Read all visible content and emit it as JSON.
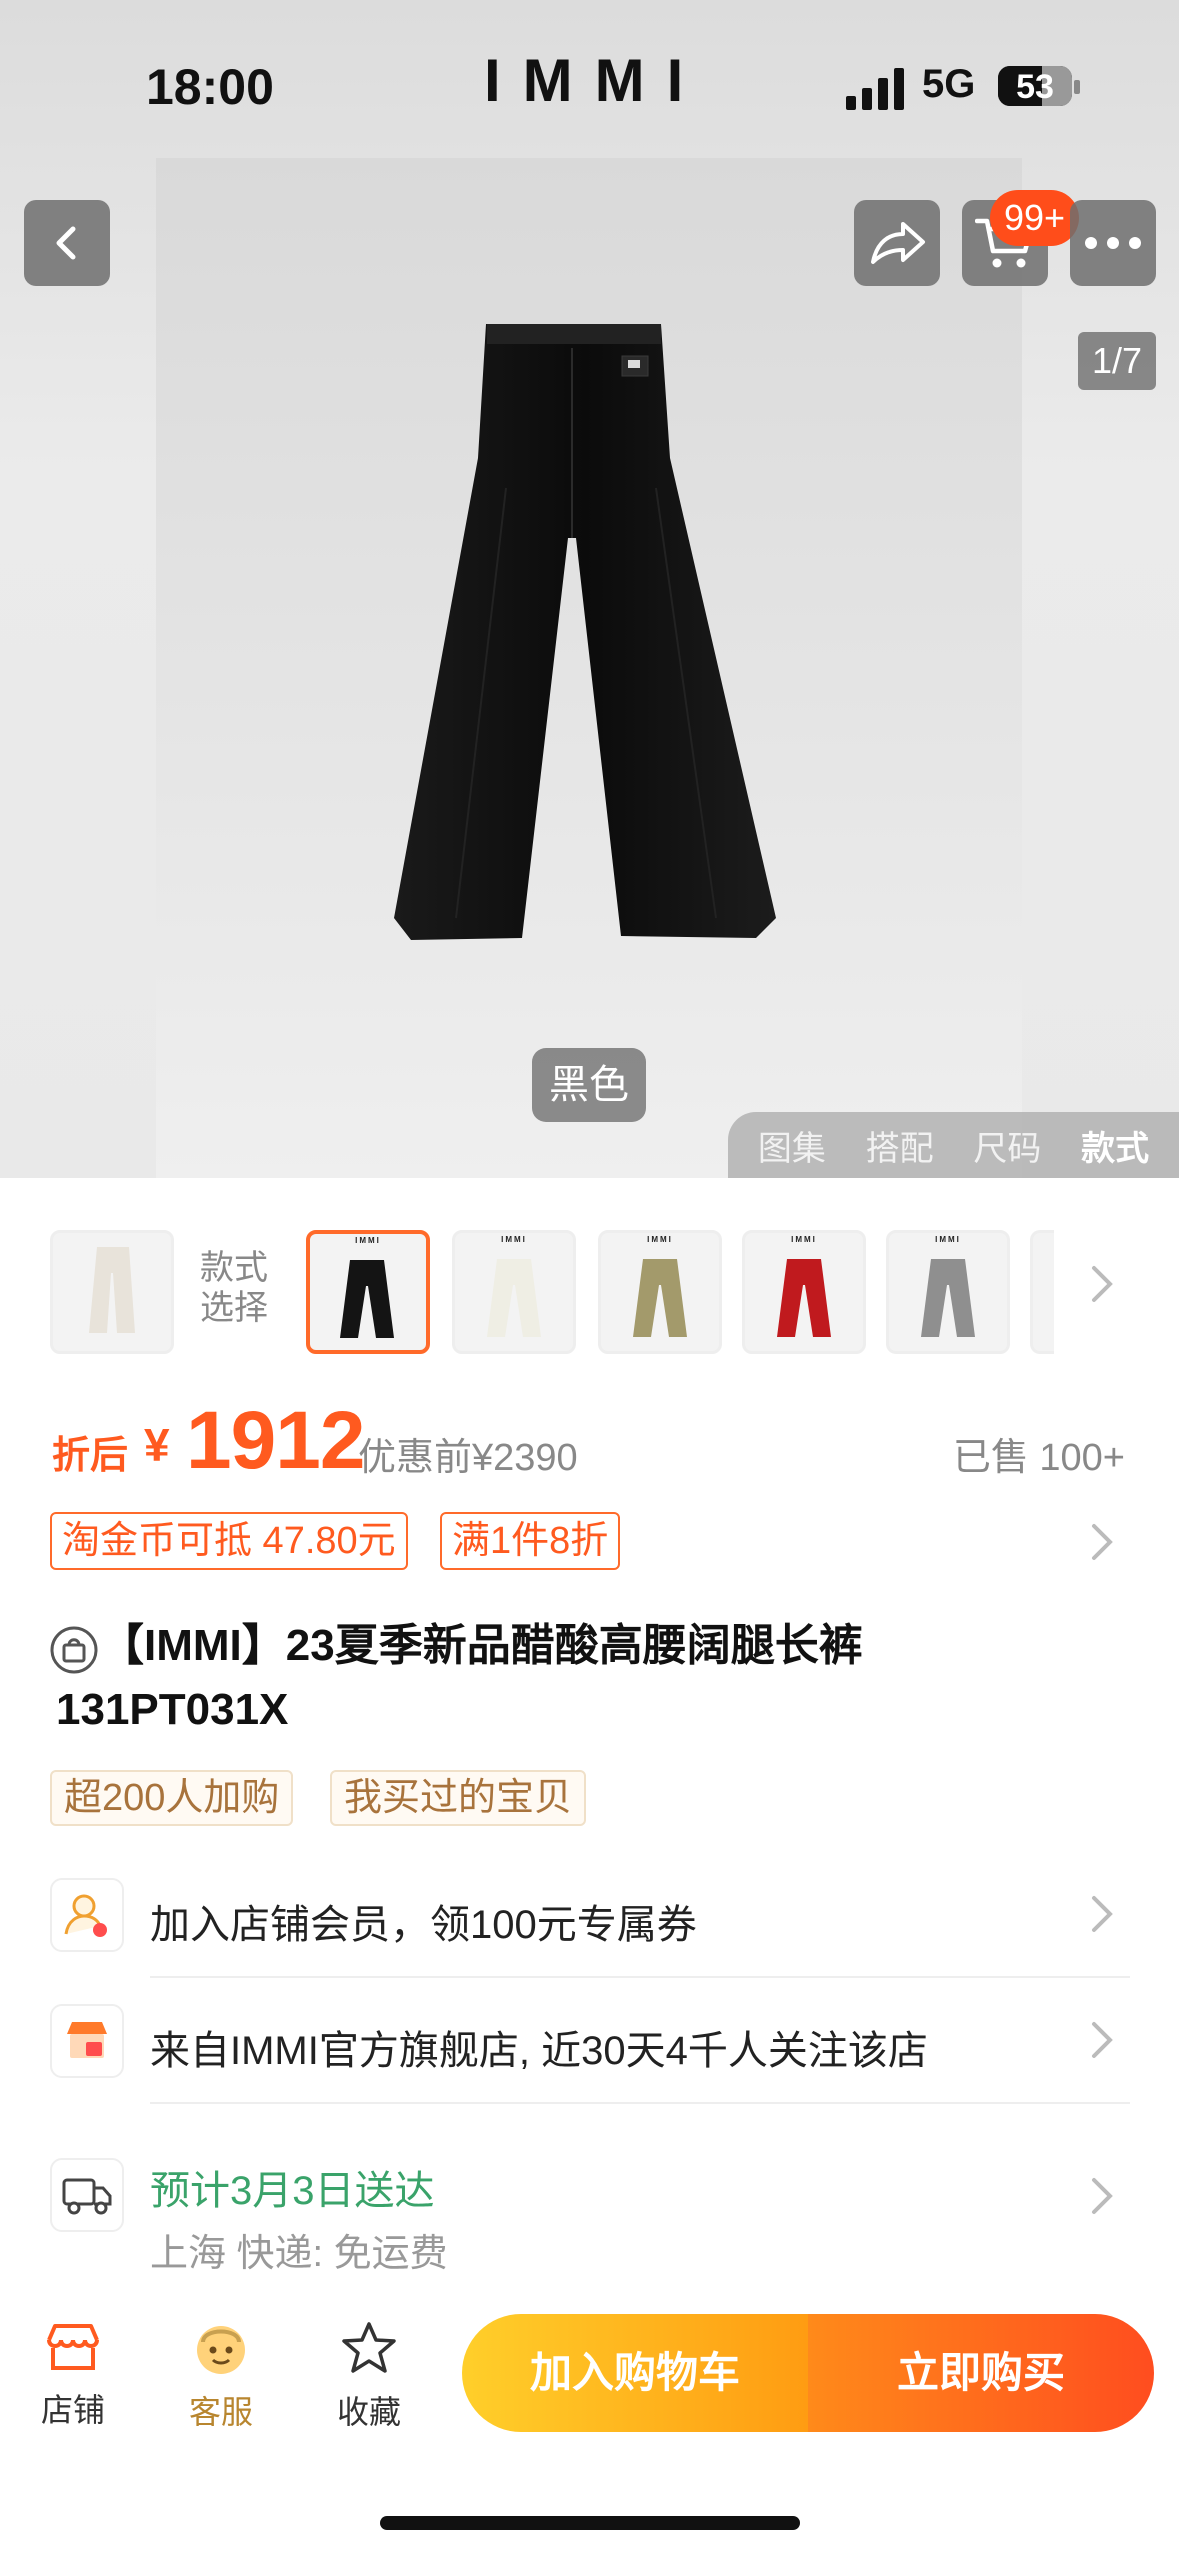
{
  "status": {
    "time": "18:00",
    "brand": "IMMI",
    "network": "5G",
    "battery": "53"
  },
  "hero": {
    "cart_badge": "99+",
    "image_counter": "1/7",
    "color_label": "黑色",
    "tabs": [
      "图集",
      "搭配",
      "尺码",
      "款式"
    ],
    "active_tab": "款式"
  },
  "thumbnails": {
    "style_label_1": "款式",
    "style_label_2": "选择",
    "brand_mark": "IMMI",
    "colors": [
      "#e8e3da",
      "#141414",
      "#efeee4",
      "#a39a6b",
      "#c01a1e",
      "#8f8f8f"
    ]
  },
  "price": {
    "prefix": "折后",
    "currency": "¥",
    "amount": "1912",
    "original": "优惠前¥2390",
    "sold": "已售 100+",
    "tags": [
      "淘金币可抵 47.80元",
      "满1件8折"
    ]
  },
  "product": {
    "title_line1": "【IMMI】23夏季新品醋酸高腰阔腿长裤",
    "title_line2": "131PT031X",
    "tags": [
      "超200人加购",
      "我买过的宝贝"
    ]
  },
  "rows": {
    "member": "加入店铺会员，领100元专属券",
    "store": "来自IMMI官方旗舰店, 近30天4千人关注该店",
    "delivery": "预计3月3日送达",
    "shipping": "上海  快递: 免运费"
  },
  "bottom": {
    "shop": "店铺",
    "service": "客服",
    "favorite": "收藏",
    "add_cart": "加入购物车",
    "buy_now": "立即购买"
  },
  "colors": {
    "accent": "#ff5a1f",
    "green": "#3aa36a",
    "tag_brown": "#a8733c"
  }
}
